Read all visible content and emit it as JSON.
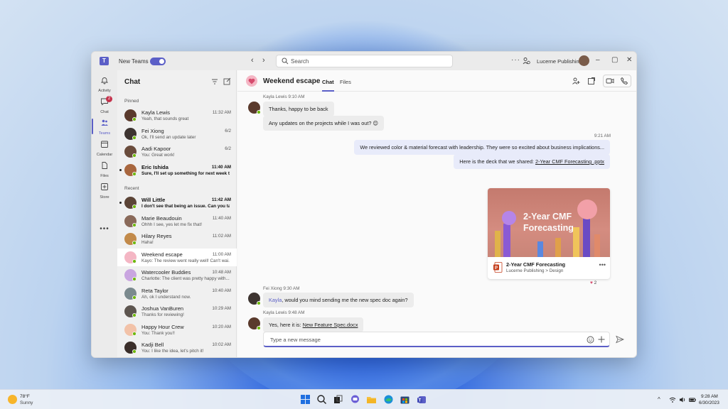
{
  "titlebar": {
    "toggle_label": "New Teams",
    "search_placeholder": "Search",
    "org_name": "Lucerne Publishing"
  },
  "rail": {
    "items": [
      {
        "label": "Activity",
        "icon": "bell-icon"
      },
      {
        "label": "Chat",
        "icon": "chat-icon",
        "badge": "2"
      },
      {
        "label": "Teams",
        "icon": "teams-icon"
      },
      {
        "label": "Calendar",
        "icon": "calendar-icon"
      },
      {
        "label": "Files",
        "icon": "file-icon"
      },
      {
        "label": "Store",
        "icon": "store-icon"
      }
    ],
    "more": "•••"
  },
  "chatlist": {
    "title": "Chat",
    "pinned_label": "Pinned",
    "recent_label": "Recent",
    "pinned": [
      {
        "name": "Kayla Lewis",
        "preview": "Yeah, that sounds great",
        "time": "11:32 AM",
        "color": "#5a3a2c"
      },
      {
        "name": "Fei Xiong",
        "preview": "Ok, I'll send an update later",
        "time": "6/2",
        "color": "#3d3430"
      },
      {
        "name": "Aadi Kapoor",
        "preview": "You: Great work!",
        "time": "6/2",
        "color": "#6a4c3c"
      },
      {
        "name": "Eric Ishida",
        "preview": "Sure, I'll set up something for next week t...",
        "time": "11:40 AM",
        "color": "#a8663e",
        "unread": true
      }
    ],
    "recent": [
      {
        "name": "Will Little",
        "preview": "I don't see that being an issue. Can you ta...",
        "time": "11:42 AM",
        "color": "#5b4436",
        "unread": true
      },
      {
        "name": "Marie Beaudouin",
        "preview": "Ohhh I see, yes let me fix that!",
        "time": "11:40 AM",
        "color": "#8a6a5a"
      },
      {
        "name": "Hilary Reyes",
        "preview": "Haha!",
        "time": "11:02 AM",
        "color": "#c28a4a"
      },
      {
        "name": "Weekend escape",
        "preview": "Kayo: The review went really well! Can't wai...",
        "time": "11:00 AM",
        "color": "#f4b6c4",
        "selected": true
      },
      {
        "name": "Watercooler Buddies",
        "preview": "Charlotte: The client was pretty happy with...",
        "time": "10:48 AM",
        "color": "#c9a5e0"
      },
      {
        "name": "Reta Taylor",
        "preview": "Ah, ok I understand now.",
        "time": "10:40 AM",
        "color": "#7b8a8e"
      },
      {
        "name": "Joshua VanBuren",
        "preview": "Thanks for reviewing!",
        "time": "10:29 AM",
        "color": "#5e5650"
      },
      {
        "name": "Happy Hour Crew",
        "preview": "You: Thank you!!",
        "time": "10:20 AM",
        "color": "#f2c2a8"
      },
      {
        "name": "Kadji Bell",
        "preview": "You: I like the idea, let's pitch it!",
        "time": "10:02 AM",
        "color": "#3a2e2a"
      }
    ]
  },
  "conversation": {
    "title": "Weekend escape",
    "tabs": {
      "chat": "Chat",
      "files": "Files"
    },
    "messages": {
      "m1_meta": "Kayla Lewis   9:10 AM",
      "m1_text": "Thanks, happy to be back",
      "m2_text": "Any updates on the projects while I was out? 😊",
      "m3_meta": "9:21 AM",
      "m3_text": "We reviewed color & material forecast with leadership. They were so excited about business implications...",
      "m4_prefix": "Here is the deck that we shared: ",
      "m4_link": "2-Year CMF Forecasting .pptx",
      "card_image_text": "2-Year CMF Forecasting",
      "card_title": "2-Year CMF Forecasting",
      "card_sub": "Lucerne Publishing > Design",
      "card_more": "•••",
      "reaction": "2",
      "m5_meta": "Fei Xiong   9:30 AM",
      "m5_mention": "Kayla",
      "m5_text": ", would you mind sending me the new spec doc again?",
      "m6_meta": "Kayla Lewis   9:48 AM",
      "m6_prefix": "Yes, here it is: ",
      "m6_link": "New Feature Spec.docx"
    },
    "compose_placeholder": "Type a new message"
  },
  "taskbar": {
    "weather_temp": "78°F",
    "weather_cond": "Sunny",
    "time": "9:28 AM",
    "date": "6/30/2023",
    "apps": [
      "windows-start-icon",
      "search-icon",
      "task-view-icon",
      "chat-icon",
      "file-explorer-icon",
      "edge-icon",
      "store-icon",
      "teams-icon"
    ]
  },
  "colors": {
    "accent": "#5b5fc7",
    "presence": "#6bb700",
    "badge": "#c4314b"
  }
}
